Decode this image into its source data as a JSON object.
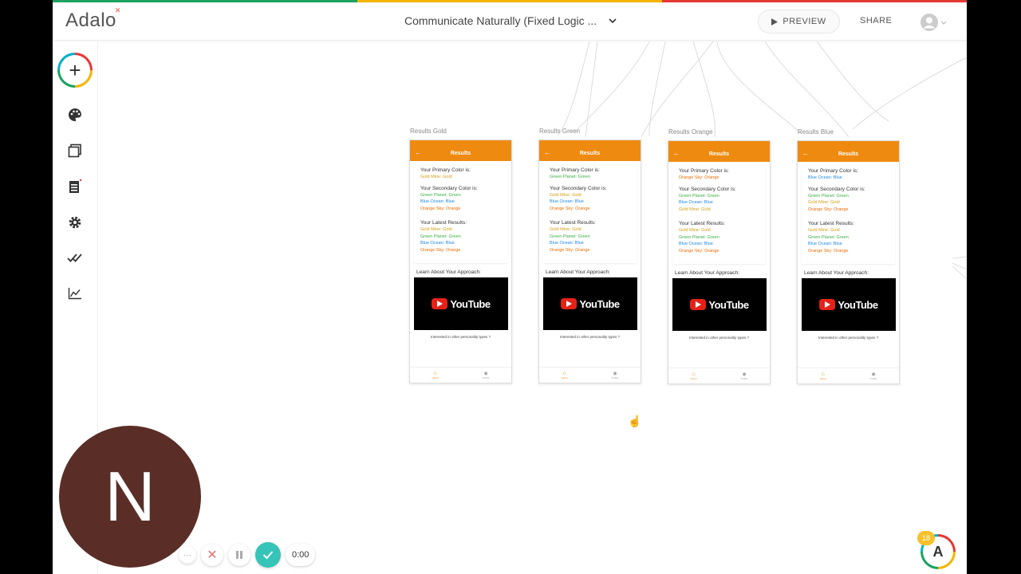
{
  "header": {
    "logo": "Adalo",
    "app_title": "Communicate Naturally (Fixed Logic ...",
    "preview_label": "PREVIEW",
    "share_label": "SHARE",
    "stripe_colors": [
      "#1aa260",
      "#f4b400",
      "#e53935"
    ]
  },
  "sidebar": {
    "items": [
      {
        "icon": "plus-icon"
      },
      {
        "icon": "palette-icon"
      },
      {
        "icon": "screens-icon"
      },
      {
        "icon": "database-icon"
      },
      {
        "icon": "gear-icon"
      },
      {
        "icon": "publish-icon"
      },
      {
        "icon": "analytics-icon"
      }
    ]
  },
  "screens": [
    {
      "label": "Results Gold",
      "title": "Results",
      "primary_label": "Your Primary Color is:",
      "primary": {
        "text": "Gold Mine: Gold",
        "color": "#d4a017"
      },
      "secondary_label": "Your Secondary Color is:",
      "secondary": [
        {
          "text": "Green Planet: Green",
          "color": "#3cb043"
        },
        {
          "text": "Blue Ocean: Blue",
          "color": "#1e88e5"
        },
        {
          "text": "Orange Sky: Orange",
          "color": "#ef6c00"
        }
      ],
      "latest_label": "Your Latest Results:",
      "latest": [
        {
          "text": "Gold Mine: Gold",
          "color": "#d4a017"
        },
        {
          "text": "Green Planet: Green",
          "color": "#3cb043"
        },
        {
          "text": "Blue Ocean: Blue",
          "color": "#1e88e5"
        },
        {
          "text": "Orange Sky: Orange",
          "color": "#ef6c00"
        }
      ],
      "learn_label": "Learn About Your Approach:",
      "video_label": "YouTube",
      "interested": "Interested in other personality types ?",
      "tabs": [
        "Home",
        "Profile"
      ]
    },
    {
      "label": "Results Green",
      "title": "Results",
      "primary_label": "Your Primary Color is:",
      "primary": {
        "text": "Green Planet: Green",
        "color": "#3cb043"
      },
      "secondary_label": "Your Secondary Color is:",
      "secondary": [
        {
          "text": "Gold Mine: Gold",
          "color": "#d4a017"
        },
        {
          "text": "Blue Ocean: Blue",
          "color": "#1e88e5"
        },
        {
          "text": "Orange Sky: Orange",
          "color": "#ef6c00"
        }
      ],
      "latest_label": "Your Latest Results:",
      "latest": [
        {
          "text": "Gold Mine: Gold",
          "color": "#d4a017"
        },
        {
          "text": "Green Planet: Green",
          "color": "#3cb043"
        },
        {
          "text": "Blue Ocean: Blue",
          "color": "#1e88e5"
        },
        {
          "text": "Orange Sky: Orange",
          "color": "#ef6c00"
        }
      ],
      "learn_label": "Learn About Your Approach:",
      "video_label": "YouTube",
      "interested": "Interested in other personality types ?",
      "tabs": [
        "Home",
        "Profile"
      ]
    },
    {
      "label": "Results Orange",
      "title": "Results",
      "primary_label": "Your Primary Color is:",
      "primary": {
        "text": "Orange Sky: Orange",
        "color": "#ef6c00"
      },
      "secondary_label": "Your Secondary Color is:",
      "secondary": [
        {
          "text": "Green Planet: Green",
          "color": "#3cb043"
        },
        {
          "text": "Blue Ocean: Blue",
          "color": "#1e88e5"
        },
        {
          "text": "Gold Mine: Gold",
          "color": "#d4a017"
        }
      ],
      "latest_label": "Your Latest Results:",
      "latest": [
        {
          "text": "Gold Mine: Gold",
          "color": "#d4a017"
        },
        {
          "text": "Green Planet: Green",
          "color": "#3cb043"
        },
        {
          "text": "Blue Ocean: Blue",
          "color": "#1e88e5"
        },
        {
          "text": "Orange Sky: Orange",
          "color": "#ef6c00"
        }
      ],
      "learn_label": "Learn About Your Approach:",
      "video_label": "YouTube",
      "interested": "Interested in other personality types ?",
      "tabs": [
        "Home",
        "Profile"
      ]
    },
    {
      "label": "Results Blue",
      "title": "Results",
      "primary_label": "Your Primary Color is:",
      "primary": {
        "text": "Blue Ocean: Blue",
        "color": "#1e88e5"
      },
      "secondary_label": "Your Secondary Color is:",
      "secondary": [
        {
          "text": "Green Planet: Green",
          "color": "#3cb043"
        },
        {
          "text": "Gold Mine: Gold",
          "color": "#d4a017"
        },
        {
          "text": "Orange Sky: Orange",
          "color": "#ef6c00"
        }
      ],
      "latest_label": "Your Latest Results:",
      "latest": [
        {
          "text": "Gold Mine: Gold",
          "color": "#d4a017"
        },
        {
          "text": "Green Planet: Green",
          "color": "#3cb043"
        },
        {
          "text": "Blue Ocean: Blue",
          "color": "#1e88e5"
        },
        {
          "text": "Orange Sky: Orange",
          "color": "#ef6c00"
        }
      ],
      "learn_label": "Learn About Your Approach:",
      "video_label": "YouTube",
      "interested": "Interested in other personality types ?",
      "tabs": [
        "Home",
        "Profile"
      ]
    }
  ],
  "notifications": {
    "count": "18"
  },
  "webcam": {
    "initial": "N"
  },
  "recorder": {
    "time": "0:00"
  }
}
